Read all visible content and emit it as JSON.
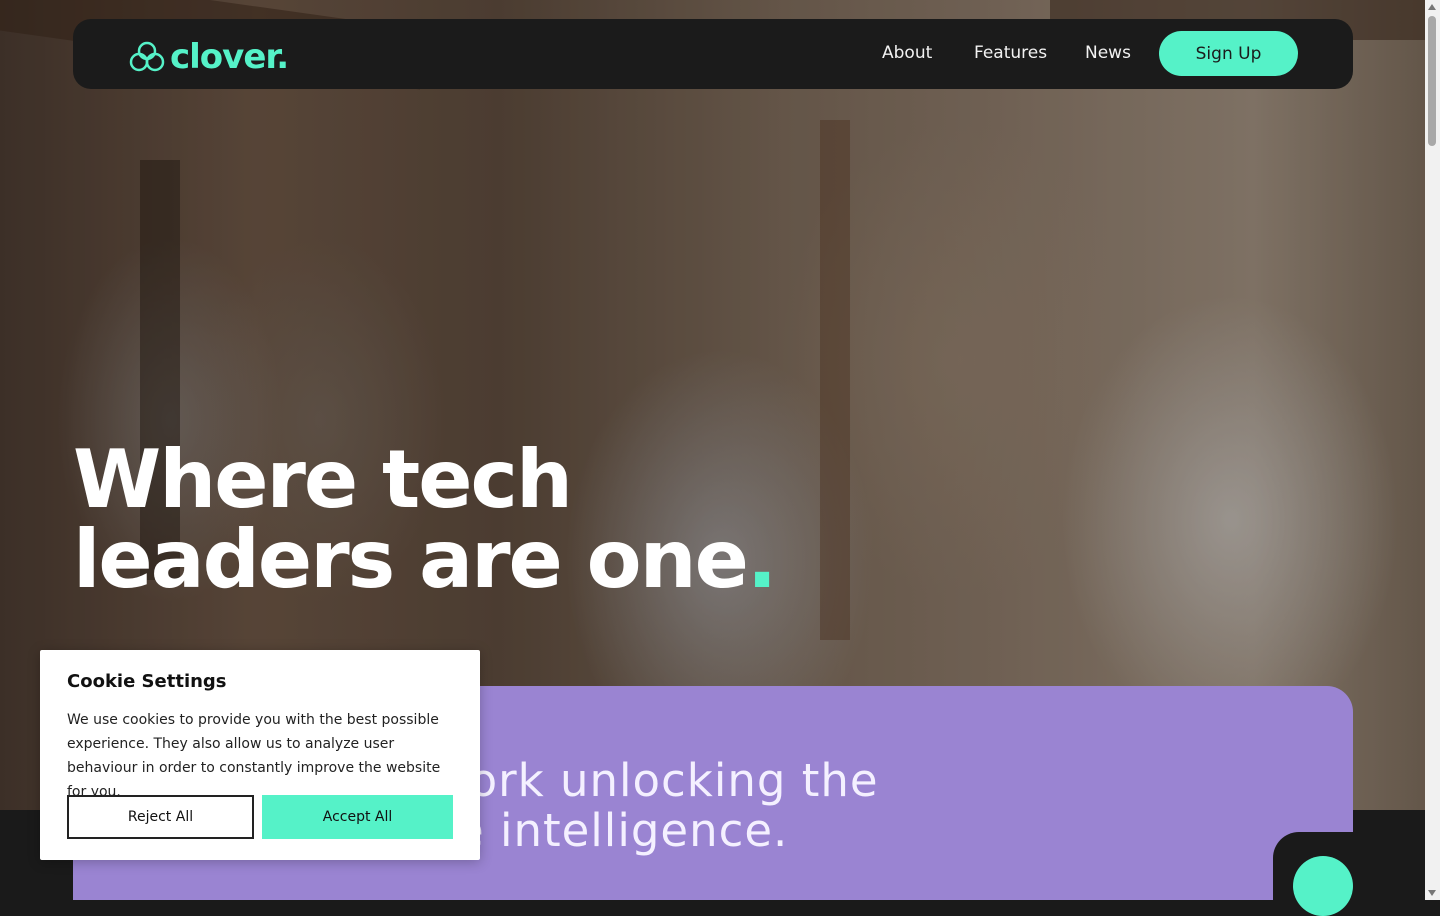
{
  "brand": {
    "name": "clover.",
    "accent": "#55f2c8",
    "icon": "clover-icon"
  },
  "nav": {
    "links": [
      {
        "label": "About"
      },
      {
        "label": "Features"
      },
      {
        "label": "News"
      }
    ],
    "cta": "Sign Up"
  },
  "hero": {
    "headline_line1": "Where tech",
    "headline_line2": "leaders are one",
    "headline_dot": ".",
    "tagline_line1": "endent network unlocking the",
    "tagline_line2": "r of collective intelligence.",
    "panel_color": "#9a84d2"
  },
  "cookie": {
    "title": "Cookie Settings",
    "body": "We use cookies to provide you with the best possible experience. They also allow us to analyze user behaviour in order to constantly improve the website for you.",
    "reject": "Reject All",
    "accept": "Accept All"
  }
}
